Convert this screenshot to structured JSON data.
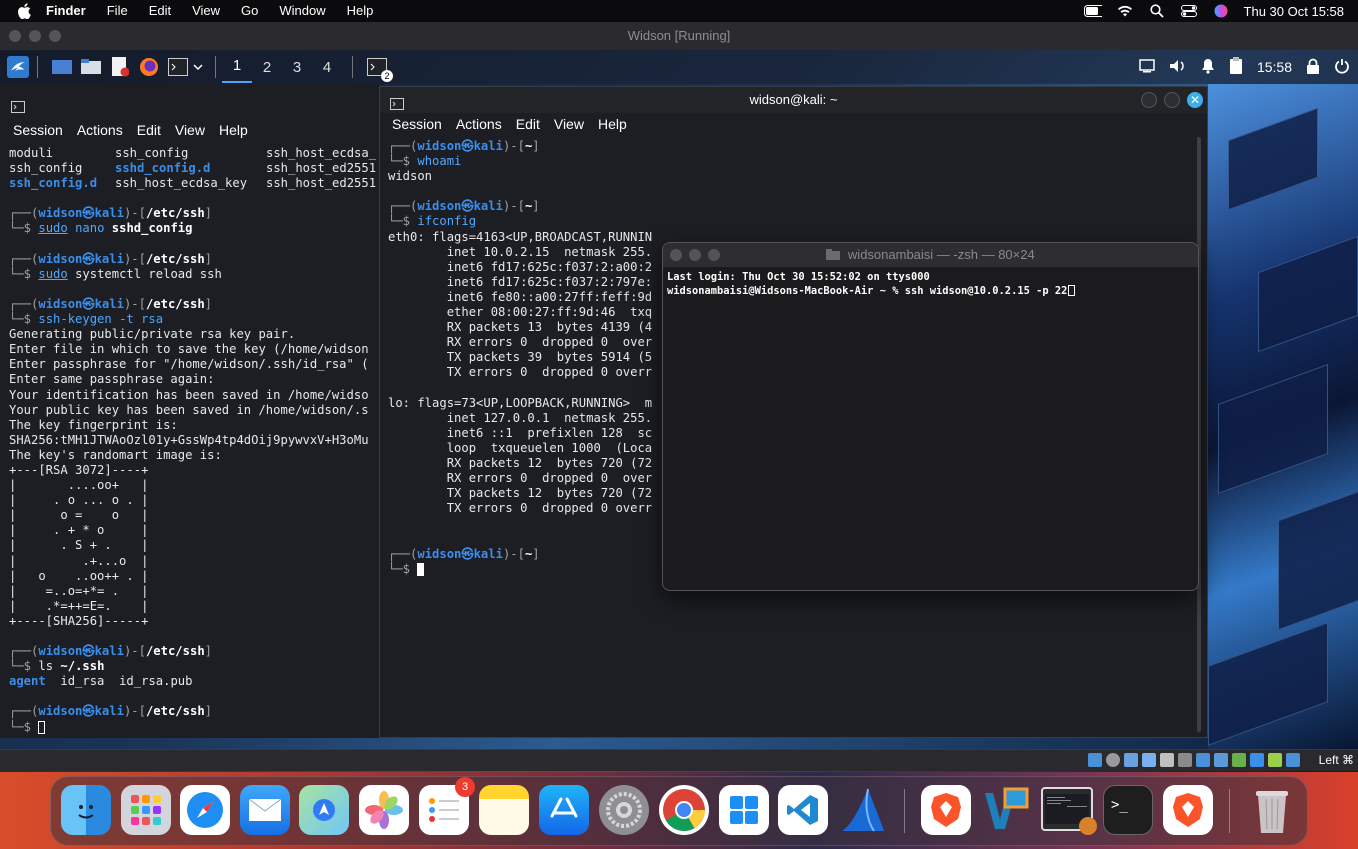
{
  "mac_menubar": {
    "app": "Finder",
    "items": [
      "File",
      "Edit",
      "View",
      "Go",
      "Window",
      "Help"
    ],
    "clock": "Thu 30 Oct  15:58"
  },
  "vm_window": {
    "title": "Widson [Running]"
  },
  "kali_panel": {
    "workspaces": [
      "1",
      "2",
      "3",
      "4"
    ],
    "active_workspace": "1",
    "terminal_count_badge": "2",
    "time": "15:58"
  },
  "left_terminal": {
    "menu": [
      "Session",
      "Actions",
      "Edit",
      "View",
      "Help"
    ],
    "ls_rows": [
      [
        "moduli",
        "ssh_config",
        "ssh_host_ecdsa_"
      ],
      [
        "ssh_config",
        "sshd_config.d",
        "ssh_host_ed2551"
      ],
      [
        "ssh_config.d",
        "ssh_host_ecdsa_key",
        "ssh_host_ed2551"
      ]
    ],
    "prompt_user": "widson",
    "prompt_host": "kali",
    "path": "/etc/ssh",
    "cmd1": {
      "a": "sudo",
      "b": "nano",
      "c": "sshd_config"
    },
    "cmd2": {
      "a": "sudo",
      "b": "systemctl reload ssh"
    },
    "cmd3": "ssh-keygen -t rsa",
    "keygen_output": [
      "Generating public/private rsa key pair.",
      "Enter file in which to save the key (/home/widson",
      "Enter passphrase for \"/home/widson/.ssh/id_rsa\" (",
      "Enter same passphrase again:",
      "Your identification has been saved in /home/widso",
      "Your public key has been saved in /home/widson/.s",
      "The key fingerprint is:",
      "SHA256:tMH1JTWAoOzl01y+GssWp4tp4dOij9pywvxV+H3oMu",
      "The key's randomart image is:",
      "+---[RSA 3072]----+",
      "|       ....oo+   |",
      "|     . o ... o . |",
      "|      o =    o   |",
      "|     . + * o     |",
      "|      . S + .    |",
      "|         .+...o  |",
      "|   o    ..oo++ . |",
      "|    =..o=+*= .   |",
      "|    .*=++=E=.    |",
      "+----[SHA256]-----+"
    ],
    "cmd4": {
      "a": "ls",
      "b": "~/.ssh"
    },
    "ls_ssh": [
      "agent",
      "id_rsa",
      "id_rsa.pub"
    ]
  },
  "mid_terminal": {
    "title": "widson@kali: ~",
    "menu": [
      "Session",
      "Actions",
      "Edit",
      "View",
      "Help"
    ],
    "prompt_user": "widson",
    "prompt_host": "kali",
    "path": "~",
    "cmd1": "whoami",
    "out1": "widson",
    "cmd2": "ifconfig",
    "ifconfig": [
      "eth0: flags=4163<UP,BROADCAST,RUNNIN",
      "        inet 10.0.2.15  netmask 255.",
      "        inet6 fd17:625c:f037:2:a00:2",
      "        inet6 fd17:625c:f037:2:797e:",
      "        inet6 fe80::a00:27ff:feff:9d",
      "        ether 08:00:27:ff:9d:46  txq",
      "        RX packets 13  bytes 4139 (4",
      "        RX errors 0  dropped 0  over",
      "        TX packets 39  bytes 5914 (5",
      "        TX errors 0  dropped 0 overr",
      "",
      "lo: flags=73<UP,LOOPBACK,RUNNING>  m",
      "        inet 127.0.0.1  netmask 255.",
      "        inet6 ::1  prefixlen 128  sc",
      "        loop  txqueuelen 1000  (Loca",
      "        RX packets 12  bytes 720 (72",
      "        RX errors 0  dropped 0  over",
      "        TX packets 12  bytes 720 (72",
      "        TX errors 0  dropped 0 overr"
    ]
  },
  "mac_terminal": {
    "title": "widsonambaisi — -zsh — 80×24",
    "line1": "Last login: Thu Oct 30 15:52:02 on ttys000",
    "line2": "widsonambaisi@Widsons-MacBook-Air ~ % ssh widson@10.0.2.15 -p 22"
  },
  "vm_status": {
    "host_key": "Left ⌘"
  },
  "dock": {
    "reminders_badge": "3",
    "apps": [
      "Finder",
      "Launchpad",
      "Safari",
      "Mail",
      "Maps",
      "Photos",
      "Reminders",
      "Notes",
      "App Store",
      "System Settings",
      "Chrome",
      "Windows App",
      "VS Code",
      "Wireshark",
      "Brave",
      "VirtualBox",
      "VM Preview",
      "Terminal",
      "Brave Beta",
      "Trash"
    ]
  },
  "colors": {
    "prompt_blue": "#3b8eea",
    "terminal_bg": "#1c1e23",
    "dock_badge": "#ee3b30"
  }
}
